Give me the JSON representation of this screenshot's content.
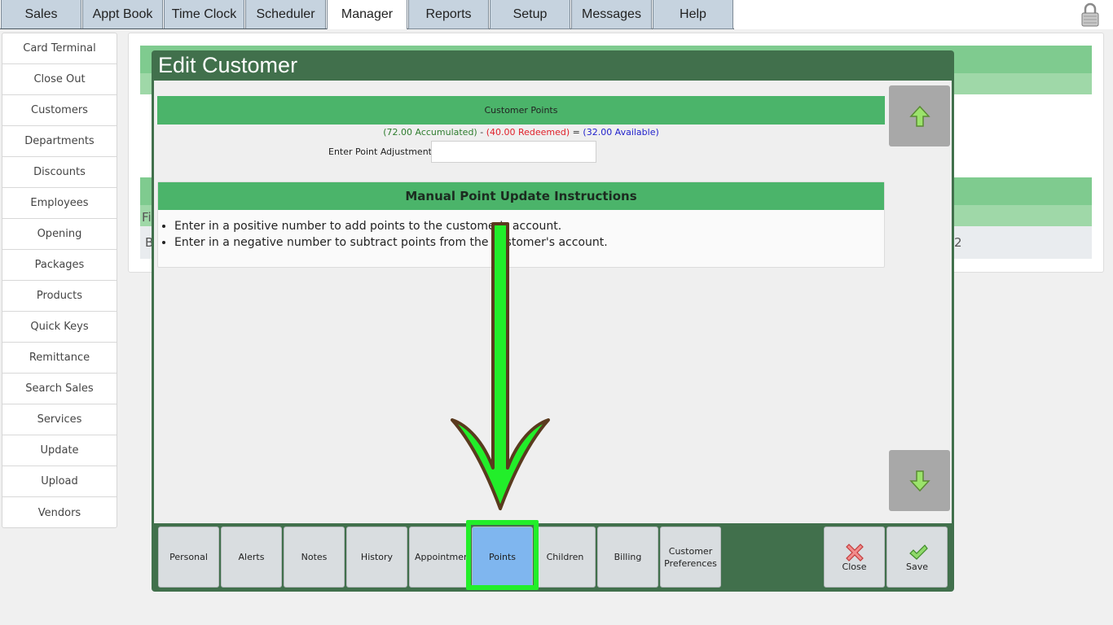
{
  "top_tabs": [
    "Sales",
    "Appt Book",
    "Time Clock",
    "Scheduler",
    "Manager",
    "Reports",
    "Setup",
    "Messages",
    "Help"
  ],
  "active_top_tab": "Manager",
  "sidebar": {
    "items": [
      "Card Terminal",
      "Close Out",
      "Customers",
      "Departments",
      "Discounts",
      "Employees",
      "Opening",
      "Packages",
      "Products",
      "Quick Keys",
      "Remittance",
      "Search Sales",
      "Services",
      "Update",
      "Upload",
      "Vendors"
    ]
  },
  "background": {
    "col_fragment": "Fi",
    "row_fragment": "B",
    "right_fragment": "2"
  },
  "modal": {
    "title": "Edit Customer",
    "points_header": "Customer Points",
    "accumulated": "(72.00 Accumulated)",
    "dash": " - ",
    "redeemed": "(40.00 Redeemed)",
    "equals": " = ",
    "available": "(32.00 Available)",
    "adjustment_label": "Enter Point Adjustment:",
    "adjustment_value": "",
    "instructions_title": "Manual Point Update Instructions",
    "instructions": [
      "Enter in a positive number to add points to the customer's account.",
      "Enter in a negative number to subtract points from the customer's account."
    ]
  },
  "customer_tabs": [
    "Personal",
    "Alerts",
    "Notes",
    "History",
    "Appointments",
    "Points",
    "Children",
    "Billing",
    "Customer",
    "Preferences"
  ],
  "active_customer_tab": "Points",
  "actions": {
    "close_label": "Close",
    "save_label": "Save"
  },
  "colors": {
    "modal_green": "#41704c",
    "header_green": "#4bb46a",
    "active_tab_blue": "#7fb6ef",
    "highlight_green": "#22ee2a"
  }
}
